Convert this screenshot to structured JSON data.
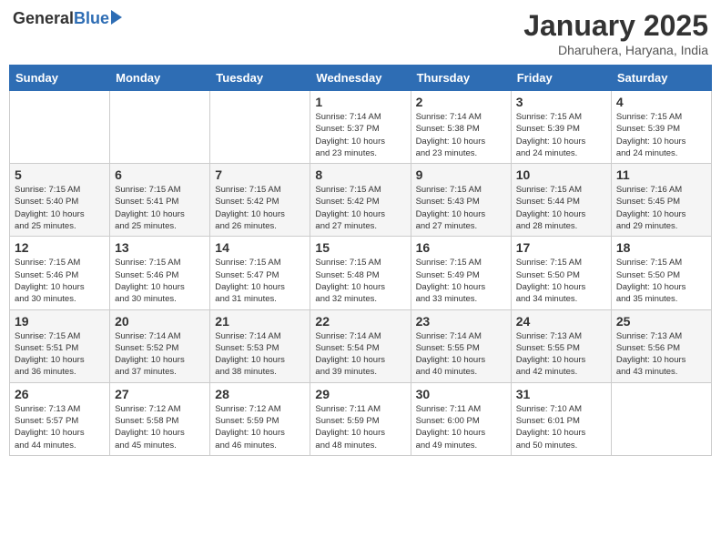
{
  "logo": {
    "general": "General",
    "blue": "Blue"
  },
  "title": "January 2025",
  "subtitle": "Dharuhera, Haryana, India",
  "days_of_week": [
    "Sunday",
    "Monday",
    "Tuesday",
    "Wednesday",
    "Thursday",
    "Friday",
    "Saturday"
  ],
  "weeks": [
    [
      {
        "day": "",
        "info": ""
      },
      {
        "day": "",
        "info": ""
      },
      {
        "day": "",
        "info": ""
      },
      {
        "day": "1",
        "info": "Sunrise: 7:14 AM\nSunset: 5:37 PM\nDaylight: 10 hours\nand 23 minutes."
      },
      {
        "day": "2",
        "info": "Sunrise: 7:14 AM\nSunset: 5:38 PM\nDaylight: 10 hours\nand 23 minutes."
      },
      {
        "day": "3",
        "info": "Sunrise: 7:15 AM\nSunset: 5:39 PM\nDaylight: 10 hours\nand 24 minutes."
      },
      {
        "day": "4",
        "info": "Sunrise: 7:15 AM\nSunset: 5:39 PM\nDaylight: 10 hours\nand 24 minutes."
      }
    ],
    [
      {
        "day": "5",
        "info": "Sunrise: 7:15 AM\nSunset: 5:40 PM\nDaylight: 10 hours\nand 25 minutes."
      },
      {
        "day": "6",
        "info": "Sunrise: 7:15 AM\nSunset: 5:41 PM\nDaylight: 10 hours\nand 25 minutes."
      },
      {
        "day": "7",
        "info": "Sunrise: 7:15 AM\nSunset: 5:42 PM\nDaylight: 10 hours\nand 26 minutes."
      },
      {
        "day": "8",
        "info": "Sunrise: 7:15 AM\nSunset: 5:42 PM\nDaylight: 10 hours\nand 27 minutes."
      },
      {
        "day": "9",
        "info": "Sunrise: 7:15 AM\nSunset: 5:43 PM\nDaylight: 10 hours\nand 27 minutes."
      },
      {
        "day": "10",
        "info": "Sunrise: 7:15 AM\nSunset: 5:44 PM\nDaylight: 10 hours\nand 28 minutes."
      },
      {
        "day": "11",
        "info": "Sunrise: 7:16 AM\nSunset: 5:45 PM\nDaylight: 10 hours\nand 29 minutes."
      }
    ],
    [
      {
        "day": "12",
        "info": "Sunrise: 7:15 AM\nSunset: 5:46 PM\nDaylight: 10 hours\nand 30 minutes."
      },
      {
        "day": "13",
        "info": "Sunrise: 7:15 AM\nSunset: 5:46 PM\nDaylight: 10 hours\nand 30 minutes."
      },
      {
        "day": "14",
        "info": "Sunrise: 7:15 AM\nSunset: 5:47 PM\nDaylight: 10 hours\nand 31 minutes."
      },
      {
        "day": "15",
        "info": "Sunrise: 7:15 AM\nSunset: 5:48 PM\nDaylight: 10 hours\nand 32 minutes."
      },
      {
        "day": "16",
        "info": "Sunrise: 7:15 AM\nSunset: 5:49 PM\nDaylight: 10 hours\nand 33 minutes."
      },
      {
        "day": "17",
        "info": "Sunrise: 7:15 AM\nSunset: 5:50 PM\nDaylight: 10 hours\nand 34 minutes."
      },
      {
        "day": "18",
        "info": "Sunrise: 7:15 AM\nSunset: 5:50 PM\nDaylight: 10 hours\nand 35 minutes."
      }
    ],
    [
      {
        "day": "19",
        "info": "Sunrise: 7:15 AM\nSunset: 5:51 PM\nDaylight: 10 hours\nand 36 minutes."
      },
      {
        "day": "20",
        "info": "Sunrise: 7:14 AM\nSunset: 5:52 PM\nDaylight: 10 hours\nand 37 minutes."
      },
      {
        "day": "21",
        "info": "Sunrise: 7:14 AM\nSunset: 5:53 PM\nDaylight: 10 hours\nand 38 minutes."
      },
      {
        "day": "22",
        "info": "Sunrise: 7:14 AM\nSunset: 5:54 PM\nDaylight: 10 hours\nand 39 minutes."
      },
      {
        "day": "23",
        "info": "Sunrise: 7:14 AM\nSunset: 5:55 PM\nDaylight: 10 hours\nand 40 minutes."
      },
      {
        "day": "24",
        "info": "Sunrise: 7:13 AM\nSunset: 5:55 PM\nDaylight: 10 hours\nand 42 minutes."
      },
      {
        "day": "25",
        "info": "Sunrise: 7:13 AM\nSunset: 5:56 PM\nDaylight: 10 hours\nand 43 minutes."
      }
    ],
    [
      {
        "day": "26",
        "info": "Sunrise: 7:13 AM\nSunset: 5:57 PM\nDaylight: 10 hours\nand 44 minutes."
      },
      {
        "day": "27",
        "info": "Sunrise: 7:12 AM\nSunset: 5:58 PM\nDaylight: 10 hours\nand 45 minutes."
      },
      {
        "day": "28",
        "info": "Sunrise: 7:12 AM\nSunset: 5:59 PM\nDaylight: 10 hours\nand 46 minutes."
      },
      {
        "day": "29",
        "info": "Sunrise: 7:11 AM\nSunset: 5:59 PM\nDaylight: 10 hours\nand 48 minutes."
      },
      {
        "day": "30",
        "info": "Sunrise: 7:11 AM\nSunset: 6:00 PM\nDaylight: 10 hours\nand 49 minutes."
      },
      {
        "day": "31",
        "info": "Sunrise: 7:10 AM\nSunset: 6:01 PM\nDaylight: 10 hours\nand 50 minutes."
      },
      {
        "day": "",
        "info": ""
      }
    ]
  ]
}
